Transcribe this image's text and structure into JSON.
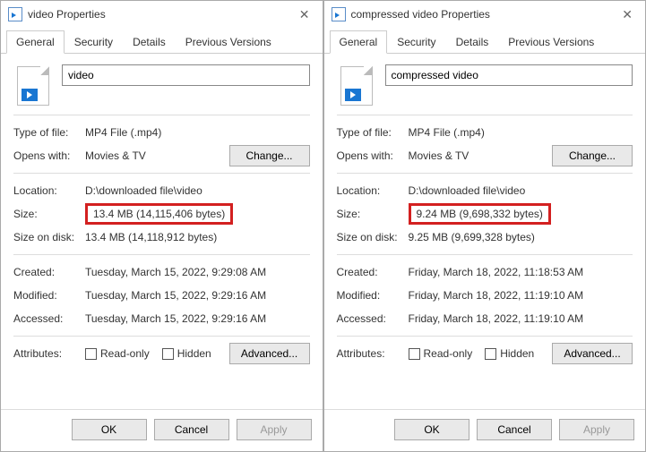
{
  "windows": [
    {
      "title": "video Properties",
      "filename": "video",
      "type": "MP4 File (.mp4)",
      "opens_with": "Movies & TV",
      "location": "D:\\downloaded file\\video",
      "size": "13.4 MB (14,115,406 bytes)",
      "size_on_disk": "13.4 MB (14,118,912 bytes)",
      "created": "Tuesday, March 15, 2022, 9:29:08 AM",
      "modified": "Tuesday, March 15, 2022, 9:29:16 AM",
      "accessed": "Tuesday, March 15, 2022, 9:29:16 AM"
    },
    {
      "title": "compressed video Properties",
      "filename": "compressed video",
      "type": "MP4 File (.mp4)",
      "opens_with": "Movies & TV",
      "location": "D:\\downloaded file\\video",
      "size": "9.24 MB (9,698,332 bytes)",
      "size_on_disk": "9.25 MB (9,699,328 bytes)",
      "created": "Friday, March 18, 2022, 11:18:53 AM",
      "modified": "Friday, March 18, 2022, 11:19:10 AM",
      "accessed": "Friday, March 18, 2022, 11:19:10 AM"
    }
  ],
  "tabs": {
    "general": "General",
    "security": "Security",
    "details": "Details",
    "previous": "Previous Versions"
  },
  "labels": {
    "type": "Type of file:",
    "opens_with": "Opens with:",
    "change": "Change...",
    "location": "Location:",
    "size": "Size:",
    "size_on_disk": "Size on disk:",
    "created": "Created:",
    "modified": "Modified:",
    "accessed": "Accessed:",
    "attributes": "Attributes:",
    "readonly": "Read-only",
    "hidden": "Hidden",
    "advanced": "Advanced...",
    "ok": "OK",
    "cancel": "Cancel",
    "apply": "Apply"
  }
}
